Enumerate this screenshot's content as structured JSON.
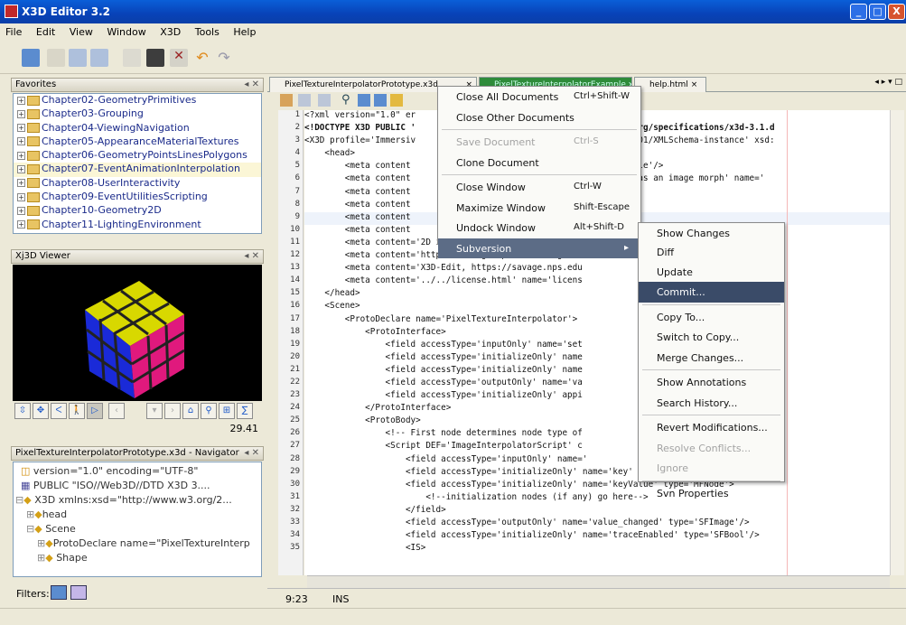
{
  "window": {
    "title": "X3D Editor 3.2",
    "controls": [
      "_",
      "□",
      "X"
    ]
  },
  "menubar": [
    "File",
    "Edit",
    "View",
    "Window",
    "X3D",
    "Tools",
    "Help"
  ],
  "favorites": {
    "title": "Favorites",
    "items": [
      "Chapter02-GeometryPrimitives",
      "Chapter03-Grouping",
      "Chapter04-ViewingNavigation",
      "Chapter05-AppearanceMaterialTextures",
      "Chapter06-GeometryPointsLinesPolygons",
      "Chapter07-EventAnimationInterpolation",
      "Chapter08-UserInteractivity",
      "Chapter09-EventUtilitiesScripting",
      "Chapter10-Geometry2D",
      "Chapter11-LightingEnvironment"
    ]
  },
  "viewer": {
    "title": "Xj3D Viewer",
    "fps": "29.41"
  },
  "navigator": {
    "title": "PixelTextureInterpolatorPrototype.x3d - Navigator",
    "rows": [
      "version=\"1.0\" encoding=\"UTF-8\"",
      "PUBLIC \"ISO//Web3D//DTD X3D 3....",
      "X3D xmlns:xsd=\"http://www.w3.org/2...",
      "head",
      "Scene",
      "ProtoDeclare name=\"PixelTextureInterp",
      "Shape"
    ],
    "filters_label": "Filters:"
  },
  "editor": {
    "tabs": [
      "PixelTextureInterpolatorPrototype.x3d",
      "PixelTextureInterpolatorExample.x3d",
      "help.html"
    ],
    "line_numbers": [
      "1",
      "2",
      "3",
      "4",
      "5",
      "6",
      "7",
      "8",
      "9",
      "10",
      "11",
      "12",
      "13",
      "14",
      "15",
      "16",
      "17",
      "18",
      "19",
      "20",
      "21",
      "22",
      "23",
      "24",
      "25",
      "26",
      "27",
      "28",
      "29",
      "30",
      "31",
      "32",
      "33",
      "34",
      "35"
    ],
    "lines": [
      "<?xml version=\"1.0\" er",
      "<!DOCTYPE X3D PUBLIC '                              ://www.web3d.org/specifications/x3d-3.1.d",
      "<X3D profile='Immersiv                              /www.w3.org/2001/XMLSchema-instance' xsd:",
      "    <head>",
      "        <meta content                              .x3d' name='title'/>",
      "        <meta content                              a PixelTexture as an image morph' name='",
      "        <meta content",
      "        <meta content",
      "        <meta content",
      "        <meta content",
      "        <meta content='2D image PixelTexture morph' nam                 eInterpolatorProt",
      "        <meta content='https://savage.nps.edu/Savage/To                 '/>",
      "        <meta content='X3D-Edit, https://savage.nps.edu                 r'/>",
      "        <meta content='../../license.html' name='licens",
      "    </head>",
      "    <Scene>",
      "        <ProtoDeclare name='PixelTextureInterpolator'>",
      "            <ProtoInterface>",
      "                <field accessType='inputOnly' name='set                 />",
      "                <field accessType='initializeOnly' name                 />",
      "                <field accessType='initializeOnly' name                 />",
      "                <field accessType='outputOnly' name='va                 e'/>",
      "                <field accessType='initializeOnly' appi                 t to trace script",
      "            </ProtoInterface>",
      "            <ProtoBody>",
      "                <!-- First node determines node type of",
      "                <Script DEF='ImageInterpolatorScript' c                 url='\"PixelTextur",
      "                    <field accessType='inputOnly' name='               oat'/>",
      "                    <field accessType='initializeOnly' name='key' type='MFFloat'/>",
      "                    <field accessType='initializeOnly' name='keyValue' type='MFNode'>",
      "                        <!--initialization nodes (if any) go here-->",
      "                    </field>",
      "                    <field accessType='outputOnly' name='value_changed' type='SFImage'/>",
      "                    <field accessType='initializeOnly' name='traceEnabled' type='SFBool'/>",
      "                    <IS>"
    ]
  },
  "status": {
    "position": "9:23",
    "mode": "INS"
  },
  "context_menu": {
    "items": [
      {
        "label": "Close All Documents",
        "shortcut": "Ctrl+Shift-W",
        "disabled": false
      },
      {
        "label": "Close Other Documents",
        "shortcut": "",
        "disabled": false
      },
      {
        "label": "Save Document",
        "shortcut": "Ctrl-S",
        "disabled": true
      },
      {
        "label": "Clone Document",
        "shortcut": "",
        "disabled": false
      },
      {
        "label": "Close Window",
        "shortcut": "Ctrl-W",
        "disabled": false
      },
      {
        "label": "Maximize Window",
        "shortcut": "Shift-Escape",
        "disabled": false
      },
      {
        "label": "Undock Window",
        "shortcut": "Alt+Shift-D",
        "disabled": false
      },
      {
        "label": "Subversion",
        "shortcut": "▸",
        "disabled": false
      }
    ]
  },
  "subversion_menu": {
    "items": [
      {
        "label": "Show Changes",
        "disabled": false
      },
      {
        "label": "Diff",
        "disabled": false
      },
      {
        "label": "Update",
        "disabled": false
      },
      {
        "label": "Commit...",
        "disabled": false
      },
      {
        "label": "Copy To...",
        "disabled": false
      },
      {
        "label": "Switch to Copy...",
        "disabled": false
      },
      {
        "label": "Merge Changes...",
        "disabled": false
      },
      {
        "label": "Show Annotations",
        "disabled": false
      },
      {
        "label": "Search History...",
        "disabled": false
      },
      {
        "label": "Revert Modifications...",
        "disabled": false
      },
      {
        "label": "Resolve Conflicts...",
        "disabled": true
      },
      {
        "label": "Ignore",
        "disabled": true
      },
      {
        "label": "Svn Properties",
        "disabled": false
      }
    ]
  },
  "colors": {
    "titlebar": "#0842b8",
    "menu_highlight": "#3a4b68",
    "tag": "#0026a8",
    "attr": "#0a6b22"
  }
}
